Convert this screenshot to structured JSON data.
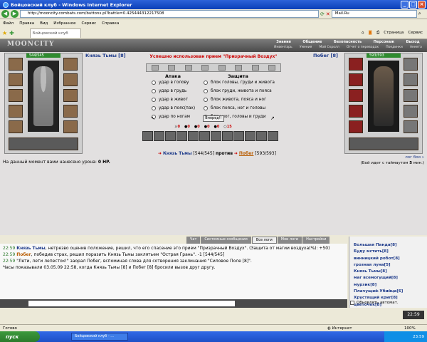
{
  "window": {
    "title": "Бойцовский клуб - Windows Internet Explorer"
  },
  "browser": {
    "url": "http://mooncity.combats.com/buttons.pl?battle=0.425444312217508",
    "search_value": "Mail.Ru",
    "menu": [
      "Файл",
      "Правка",
      "Вид",
      "Избранное",
      "Сервис",
      "Справка"
    ],
    "tab_label": "Бойцовский клуб",
    "tools": [
      "Страница",
      "Сервис"
    ]
  },
  "game": {
    "logo": "MOONCITY",
    "nav_top": [
      "Знания",
      "Общение",
      "Безопасность",
      "Персонаж",
      "Выход"
    ],
    "nav_bottom": [
      "Инвентарь",
      "Умения",
      "Мой Скролл",
      "Отчет о переводах",
      "Поединки",
      "Анкета"
    ],
    "player": {
      "name": "Князь Тьмы",
      "level": "[8]",
      "hp": "544/545"
    },
    "enemy": {
      "name": "Побег",
      "level": "[8]",
      "hp": "593/593"
    },
    "success_msg": "Успешно использован прием \"Призрачный Воздух\"",
    "attack_header": "Атака",
    "defense_header": "Защита",
    "attacks": [
      "удар в голову",
      "удар в грудь",
      "удар в живот",
      "удар в пояс(пах)",
      "удар по ногам"
    ],
    "defenses": [
      "блок головы, груди и живота",
      "блок груди, живота и пояса",
      "блок живота, пояса и ног",
      "блок пояса, ног и головы",
      "блок ног, головы и груди"
    ],
    "forward_button": "Вперед!!",
    "counters": [
      "0",
      "0",
      "0",
      "0",
      "0",
      "15"
    ],
    "vs_word": "против",
    "player_hp_label": "[544/545]",
    "enemy_hp_label": "[593/593]",
    "damage_prefix": "На данный момент вами нанесено урона:",
    "damage_value": "0 HP.",
    "fight_log_link": "лог боя »",
    "timeout_prefix": "(Бой идет с таймаутом",
    "timeout_value": "5",
    "timeout_suffix": "мин.)"
  },
  "chat": {
    "tabs": [
      "Чат",
      "Системные сообщения",
      "Все логи",
      "Мои логи",
      "Настройки"
    ],
    "lines": [
      {
        "time": "22:59",
        "name": "Князь Тьмы",
        "text": ", нетрезво оценив положение, решил, что его спасение это прием \"Призрачный Воздух\". (Защита от магии воздуха(%): +50)"
      },
      {
        "time": "22:59",
        "name": "Побег",
        "text": ", победив страх, решил поразить Князь Тьмы заклятьем \"Острая Грань\". -1 [544/545]"
      },
      {
        "time": "22:59",
        "name": "",
        "text": "\"Лети, лети лепесток!\" заорал Побег, вспоминая слова для сотворения заклинания \"Силовое Поле [8]\"."
      },
      {
        "time": "",
        "name": "",
        "text": "Часы показывали 03.05.09 22:58, когда Князь Тьмы [8] и Побег [8] бросили вызов друг другу."
      }
    ],
    "users": [
      "Большая Панда[8]",
      "Буду мстить[8]",
      "винницкий робот[8]",
      "грозная луна[5]",
      "Князь Тьмы[8]",
      "маг всемогущий[8]",
      "мурзик[8]",
      "Плачущий-Убийца[6]",
      "Хрустящий криг[8]",
      "цветочек[8]"
    ],
    "auto_update": "Обновлять автомат.",
    "clock": "22:59"
  },
  "statusbar": {
    "left": "Готово",
    "internet": "Интернет",
    "zoom": "100%"
  },
  "taskbar": {
    "start": "пуск",
    "item": "Бойцовский клуб - ...",
    "time": "23:59"
  }
}
